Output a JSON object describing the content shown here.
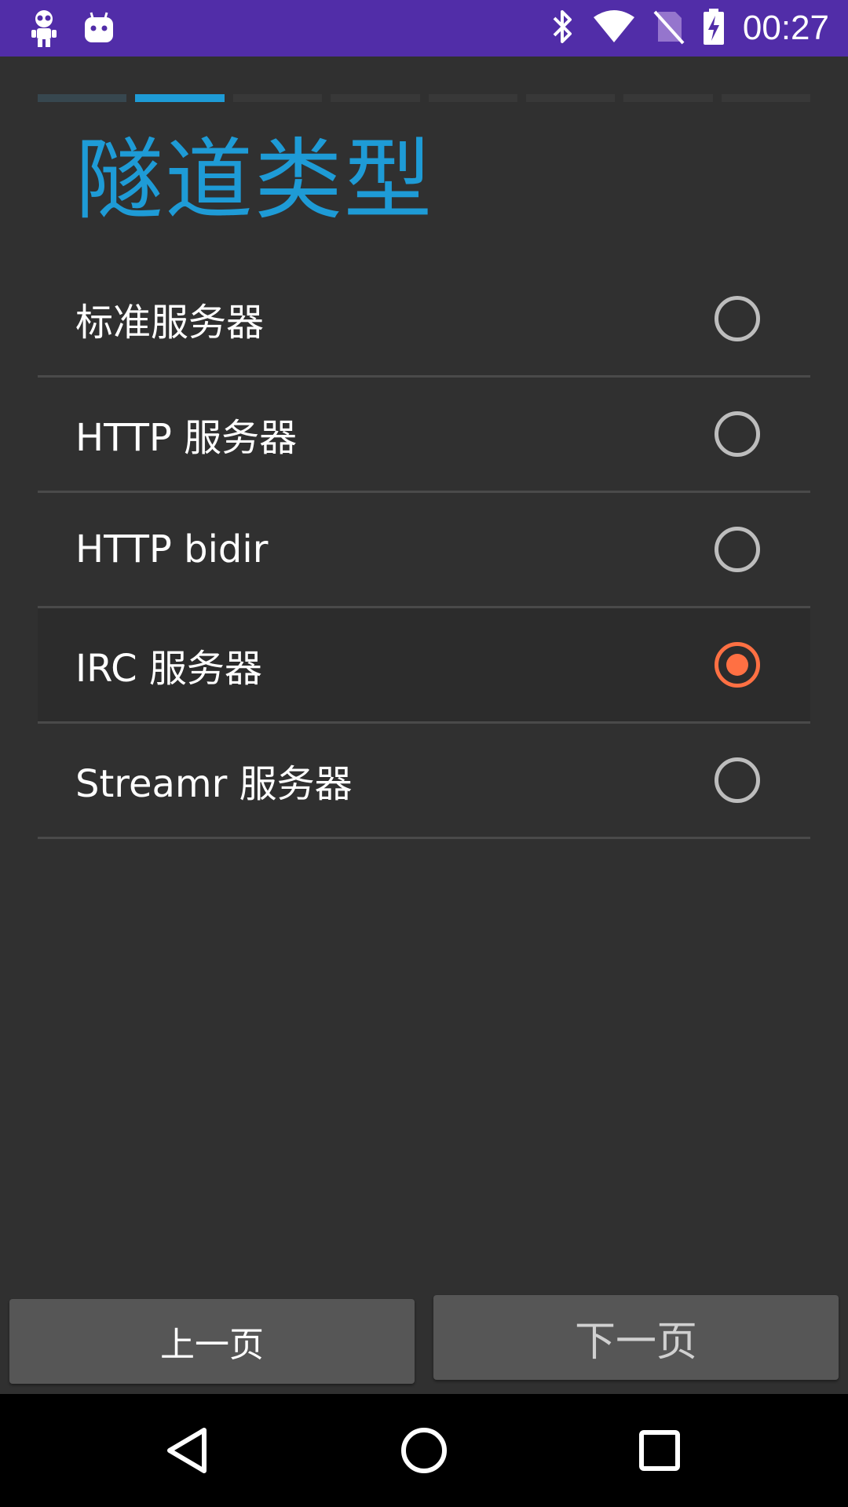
{
  "status_bar": {
    "time": "00:27",
    "background": "#512da8",
    "left_icons": [
      "robot-app-icon",
      "android-app-icon"
    ],
    "right_icons": [
      "bluetooth-icon",
      "wifi-icon",
      "no-sim-icon",
      "battery-charging-icon"
    ]
  },
  "steps": {
    "total": 8,
    "current_index": 1,
    "colors": {
      "done": "#37474f",
      "current": "#1e9bd6",
      "pending": "#383838"
    }
  },
  "title": "隧道类型",
  "options": [
    {
      "label": "标准服务器",
      "selected": false
    },
    {
      "label": "HTTP 服务器",
      "selected": false
    },
    {
      "label": "HTTP bidir",
      "selected": false
    },
    {
      "label": "IRC 服务器",
      "selected": true
    },
    {
      "label": "Streamr 服务器",
      "selected": false
    }
  ],
  "buttons": {
    "prev_label": "上一页",
    "next_label": "下一页"
  },
  "nav_bar": {
    "icons": [
      "back-icon",
      "home-icon",
      "recents-icon"
    ]
  },
  "colors": {
    "accent": "#1e9bd6",
    "radio_selected": "#ff7043",
    "radio_unselected": "#bdbdbd",
    "background": "#303030"
  }
}
